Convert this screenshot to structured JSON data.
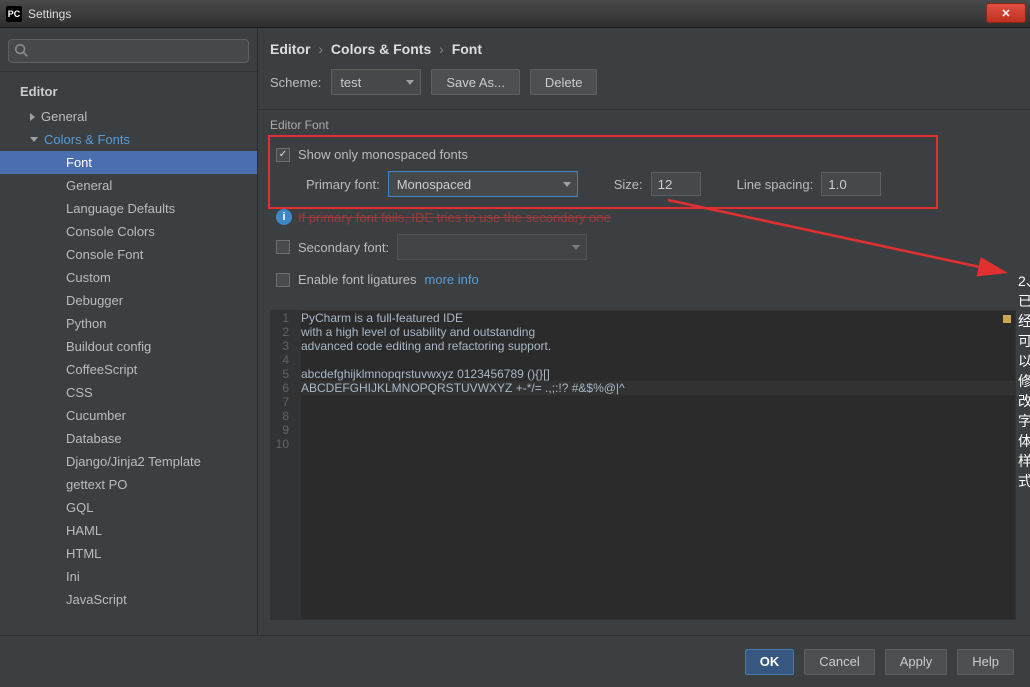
{
  "window": {
    "title": "Settings",
    "logo": "PC"
  },
  "sidebar": {
    "search_placeholder": "",
    "section": "Editor",
    "items": [
      {
        "label": "General",
        "expand": "right"
      },
      {
        "label": "Colors & Fonts",
        "expand": "down",
        "expanded": true
      },
      {
        "label": "Font",
        "selected": true,
        "lvl": 2
      },
      {
        "label": "General",
        "lvl": 2
      },
      {
        "label": "Language Defaults",
        "lvl": 2
      },
      {
        "label": "Console Colors",
        "lvl": 2
      },
      {
        "label": "Console Font",
        "lvl": 2
      },
      {
        "label": "Custom",
        "lvl": 2
      },
      {
        "label": "Debugger",
        "lvl": 2
      },
      {
        "label": "Python",
        "lvl": 2
      },
      {
        "label": "Buildout config",
        "lvl": 2
      },
      {
        "label": "CoffeeScript",
        "lvl": 2
      },
      {
        "label": "CSS",
        "lvl": 2
      },
      {
        "label": "Cucumber",
        "lvl": 2
      },
      {
        "label": "Database",
        "lvl": 2
      },
      {
        "label": "Django/Jinja2 Template",
        "lvl": 2
      },
      {
        "label": "gettext PO",
        "lvl": 2
      },
      {
        "label": "GQL",
        "lvl": 2
      },
      {
        "label": "HAML",
        "lvl": 2
      },
      {
        "label": "HTML",
        "lvl": 2
      },
      {
        "label": "Ini",
        "lvl": 2
      },
      {
        "label": "JavaScript",
        "lvl": 2
      }
    ]
  },
  "breadcrumb": {
    "a": "Editor",
    "b": "Colors & Fonts",
    "c": "Font"
  },
  "scheme": {
    "label": "Scheme:",
    "value": "test",
    "save_as": "Save As...",
    "delete": "Delete"
  },
  "editor_font": {
    "title": "Editor Font",
    "show_mono": "Show only monospaced fonts",
    "show_mono_checked": true,
    "primary_label": "Primary font:",
    "primary_value": "Monospaced",
    "size_label": "Size:",
    "size_value": "12",
    "spacing_label": "Line spacing:",
    "spacing_value": "1.0",
    "fallback_info": "If primary font fails, IDE tries to use the secondary one",
    "secondary_label": "Secondary font:",
    "ligatures": "Enable font ligatures",
    "more_info": "more info"
  },
  "preview": {
    "lines": [
      "PyCharm is a full-featured IDE",
      "with a high level of usability and outstanding",
      "advanced code editing and refactoring support.",
      "",
      "abcdefghijklmnopqrstuvwxyz 0123456789 (){}[]",
      "ABCDEFGHIJKLMNOPQRSTUVWXYZ +-*/= .,;:!? #&$%@|^",
      "",
      "",
      "",
      ""
    ]
  },
  "annotation": {
    "text": "2、已经可以修改字体样式"
  },
  "footer": {
    "ok": "OK",
    "cancel": "Cancel",
    "apply": "Apply",
    "help": "Help"
  }
}
